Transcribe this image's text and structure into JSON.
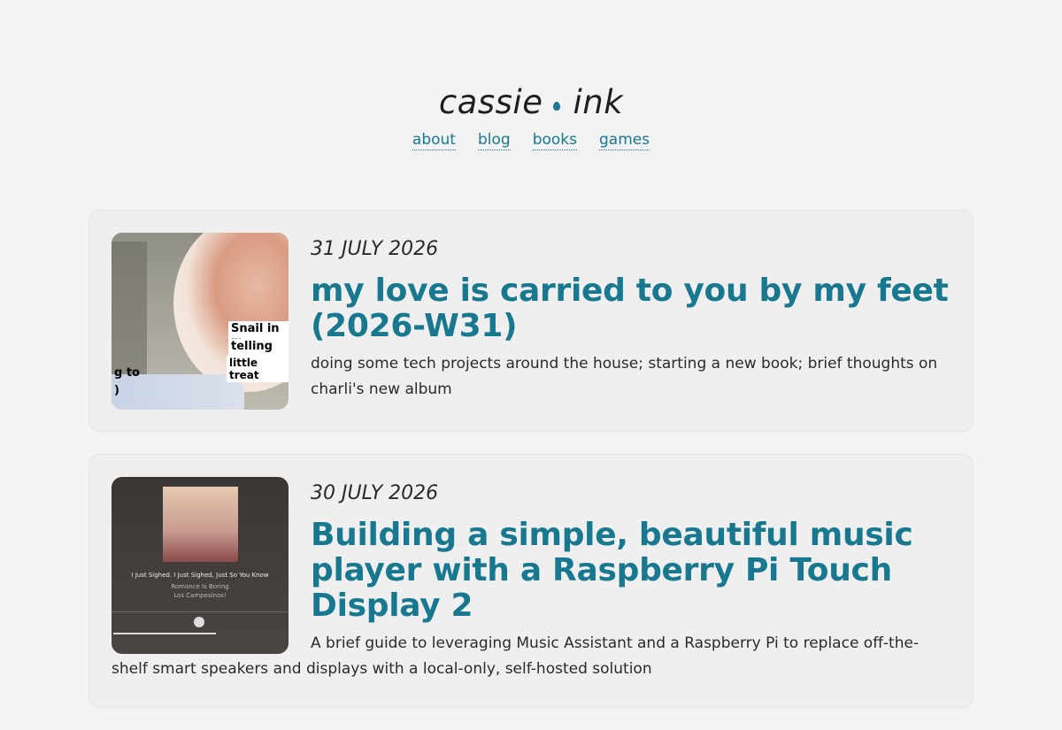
{
  "site": {
    "logo_left": "cassie",
    "logo_right": "ink",
    "accent": "#17788f"
  },
  "nav": [
    {
      "label": "about"
    },
    {
      "label": "blog"
    },
    {
      "label": "books"
    },
    {
      "label": "games"
    }
  ],
  "posts": [
    {
      "date": "31 JULY 2026",
      "title": "my love is carried to you by my feet (2026-W31)",
      "summary": "doing some tech projects around the house; starting a new book; brief thoughts on charli's new album",
      "thumb_captions": [
        "Snail in m",
        "telling me",
        "little treat",
        "g to",
        ")"
      ]
    },
    {
      "date": "30 JULY 2026",
      "title": "Building a simple, beautiful music player with a Raspberry Pi Touch Display 2",
      "summary": "A brief guide to leveraging Music Assistant and a Raspberry Pi to replace off-the-shelf smart speakers and displays with a local-only, self-hosted solution",
      "thumb_track": "I Just Sighed. I Just Sighed, Just So You Know",
      "thumb_album": "Romance Is Boring",
      "thumb_artist": "Los Campesinos!"
    }
  ]
}
